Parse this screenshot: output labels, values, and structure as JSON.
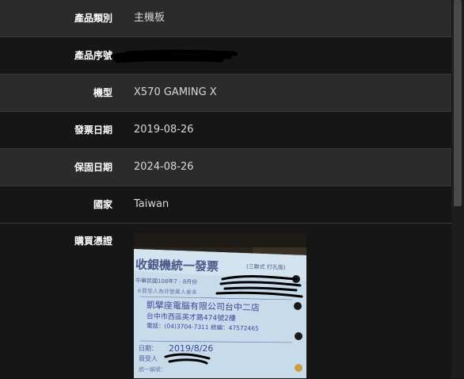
{
  "product": {
    "rows": [
      {
        "label": "產品類別",
        "value": "主機板"
      },
      {
        "label": "產品序號",
        "value": ""
      },
      {
        "label": "機型",
        "value": "X570 GAMING X"
      },
      {
        "label": "發票日期",
        "value": "2019-08-26"
      },
      {
        "label": "保固日期",
        "value": "2024-08-26"
      },
      {
        "label": "國家",
        "value": "Taiwan"
      },
      {
        "label": "購買憑證",
        "value": ""
      }
    ]
  },
  "receipt": {
    "header": "收銀機統一發票",
    "header_note": "(三聯式 打孔版)",
    "period": "中華民國108年7 - 8月份",
    "buyer_note": "※買受人為非營業人者本",
    "store_name": "凱擘座電腦有限公司台中二店",
    "address": "台中市西區英才路474號2樓",
    "phone": "電話：(04)3704-7311 統編：47572465",
    "date_label": "日期：",
    "date_value": "2019/8/26",
    "buyer_label": "買受人",
    "unified_label": "統一編號："
  }
}
